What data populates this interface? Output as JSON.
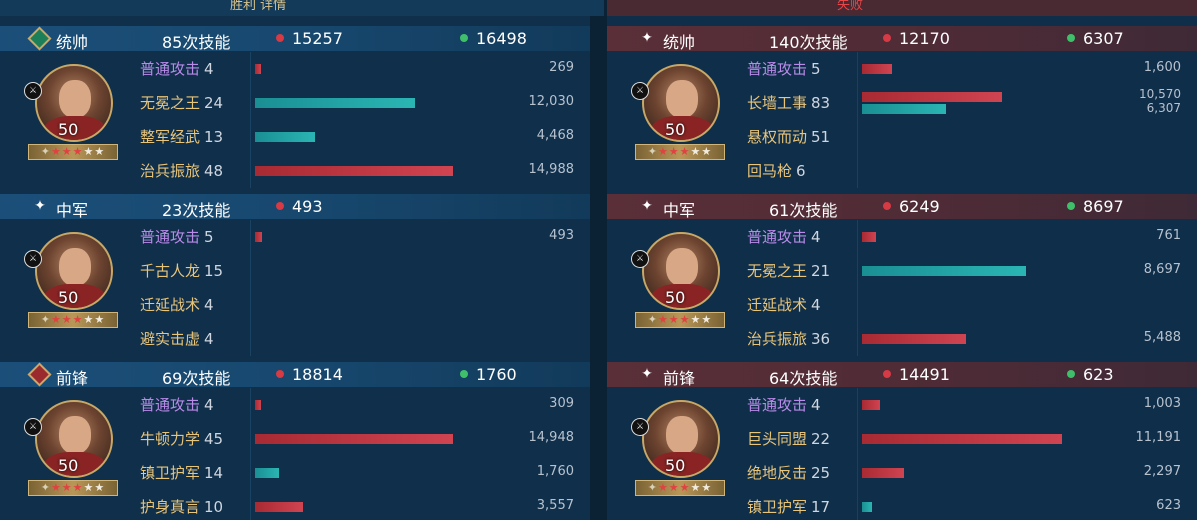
{
  "top": {
    "left_title": "胜利 详情",
    "right_title": "失败"
  },
  "left": {
    "sections": [
      {
        "rank": "统帅",
        "skill_count": "85次技能",
        "damage": "15257",
        "heal": "16498",
        "level": "50",
        "skills": [
          {
            "name": "普通攻击",
            "count": "4",
            "value": "269",
            "normal": true,
            "damage_ratio": 0.02
          },
          {
            "name": "无冕之王",
            "count": "24",
            "value": "12,030",
            "heal_ratio": 0.8
          },
          {
            "name": "整军经武",
            "count": "13",
            "value": "4,468",
            "heal_ratio": 0.3
          },
          {
            "name": "治兵振旅",
            "count": "48",
            "value": "14,988",
            "damage_ratio": 0.99
          }
        ]
      },
      {
        "rank": "中军",
        "skill_count": "23次技能",
        "damage": "493",
        "heal": "",
        "level": "50",
        "skills": [
          {
            "name": "普通攻击",
            "count": "5",
            "value": "493",
            "normal": true,
            "damage_ratio": 0.035
          },
          {
            "name": "千古人龙",
            "count": "15",
            "value": ""
          },
          {
            "name": "迁延战术",
            "count": "4",
            "value": ""
          },
          {
            "name": "避实击虚",
            "count": "4",
            "value": ""
          }
        ]
      },
      {
        "rank": "前锋",
        "skill_count": "69次技能",
        "damage": "18814",
        "heal": "1760",
        "level": "50",
        "skills": [
          {
            "name": "普通攻击",
            "count": "4",
            "value": "309",
            "normal": true,
            "damage_ratio": 0.02
          },
          {
            "name": "牛顿力学",
            "count": "45",
            "value": "14,948",
            "damage_ratio": 0.99
          },
          {
            "name": "镇卫护军",
            "count": "14",
            "value": "1,760",
            "heal_ratio": 0.12
          },
          {
            "name": "护身真言",
            "count": "10",
            "value": "3,557",
            "damage_ratio": 0.24
          }
        ]
      }
    ]
  },
  "right": {
    "sections": [
      {
        "rank": "统帅",
        "skill_count": "140次技能",
        "damage": "12170",
        "heal": "6307",
        "level": "50",
        "skills": [
          {
            "name": "普通攻击",
            "count": "5",
            "value": "1,600",
            "normal": true,
            "damage_ratio": 0.15
          },
          {
            "name": "长墙工事",
            "count": "83",
            "value": "10,570",
            "value2": "6,307",
            "damage_ratio": 1.0,
            "heal_ratio": 0.6
          },
          {
            "name": "悬权而动",
            "count": "51",
            "value": ""
          },
          {
            "name": "回马枪",
            "count": "6",
            "value": ""
          }
        ]
      },
      {
        "rank": "中军",
        "skill_count": "61次技能",
        "damage": "6249",
        "heal": "8697",
        "level": "50",
        "skills": [
          {
            "name": "普通攻击",
            "count": "4",
            "value": "761",
            "normal": true,
            "damage_ratio": 0.07
          },
          {
            "name": "无冕之王",
            "count": "21",
            "value": "8,697",
            "heal_ratio": 0.82
          },
          {
            "name": "迁延战术",
            "count": "4",
            "value": ""
          },
          {
            "name": "治兵振旅",
            "count": "36",
            "value": "5,488",
            "damage_ratio": 0.52
          }
        ]
      },
      {
        "rank": "前锋",
        "skill_count": "64次技能",
        "damage": "14491",
        "heal": "623",
        "level": "50",
        "skills": [
          {
            "name": "普通攻击",
            "count": "4",
            "value": "1,003",
            "normal": true,
            "damage_ratio": 0.09
          },
          {
            "name": "巨头同盟",
            "count": "22",
            "value": "11,191",
            "damage_ratio": 1.0
          },
          {
            "name": "绝地反击",
            "count": "25",
            "value": "2,297",
            "damage_ratio": 0.21
          },
          {
            "name": "镇卫护军",
            "count": "17",
            "value": "623",
            "heal_ratio": 0.05
          }
        ]
      }
    ]
  },
  "stars": "★★★★★",
  "colors": {
    "damage": "#d04451",
    "heal": "#2ab5b3",
    "gold_text": "#e9c57a",
    "normal_attack": "#b98be8"
  },
  "icons": {
    "damage_dot": "red-dot-icon",
    "heal_dot": "green-dot-icon",
    "rank_marker": "sparkle-icon"
  }
}
